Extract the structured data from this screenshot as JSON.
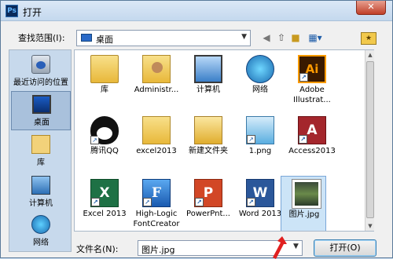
{
  "window": {
    "title": "打开",
    "app_icon": "Ps"
  },
  "toolbar": {
    "look_in_label": "查找范围(I):",
    "look_in_value": "桌面",
    "view_icon": "▦▾"
  },
  "places": [
    {
      "name": "recent",
      "label": "最近访问的位置",
      "selected": false
    },
    {
      "name": "desktop",
      "label": "桌面",
      "selected": true
    },
    {
      "name": "libraries",
      "label": "库",
      "selected": false
    },
    {
      "name": "computer",
      "label": "计算机",
      "selected": false
    },
    {
      "name": "network",
      "label": "网络",
      "selected": false
    }
  ],
  "files": [
    {
      "label": "库",
      "icon": "folder"
    },
    {
      "label": "Administr...",
      "icon": "user-folder"
    },
    {
      "label": "计算机",
      "icon": "computer"
    },
    {
      "label": "网络",
      "icon": "network"
    },
    {
      "label": "Adobe Illustrat...",
      "icon": "illustrator",
      "glyph": "Ai"
    },
    {
      "label": "腾讯QQ",
      "icon": "qq"
    },
    {
      "label": "excel2013",
      "icon": "folder"
    },
    {
      "label": "新建文件夹",
      "icon": "folder"
    },
    {
      "label": "1.png",
      "icon": "png"
    },
    {
      "label": "Access2013",
      "icon": "access",
      "glyph": "A"
    },
    {
      "label": "Excel 2013",
      "icon": "excel",
      "glyph": "X"
    },
    {
      "label": "High-Logic FontCreator",
      "icon": "fontcreator",
      "glyph": "F"
    },
    {
      "label": "PowerPnt...",
      "icon": "powerpoint",
      "glyph": "P"
    },
    {
      "label": "Word 2013",
      "icon": "word",
      "glyph": "W"
    },
    {
      "label": "图片.jpg",
      "icon": "photo"
    }
  ],
  "filename": {
    "label": "文件名(N):",
    "value": "图片.jpg"
  },
  "buttons": {
    "open": "打开(O)",
    "close": "✕"
  },
  "colors": {
    "accent": "#3c7fb1",
    "selection": "#cce4f7",
    "arrow": "#e02020"
  }
}
